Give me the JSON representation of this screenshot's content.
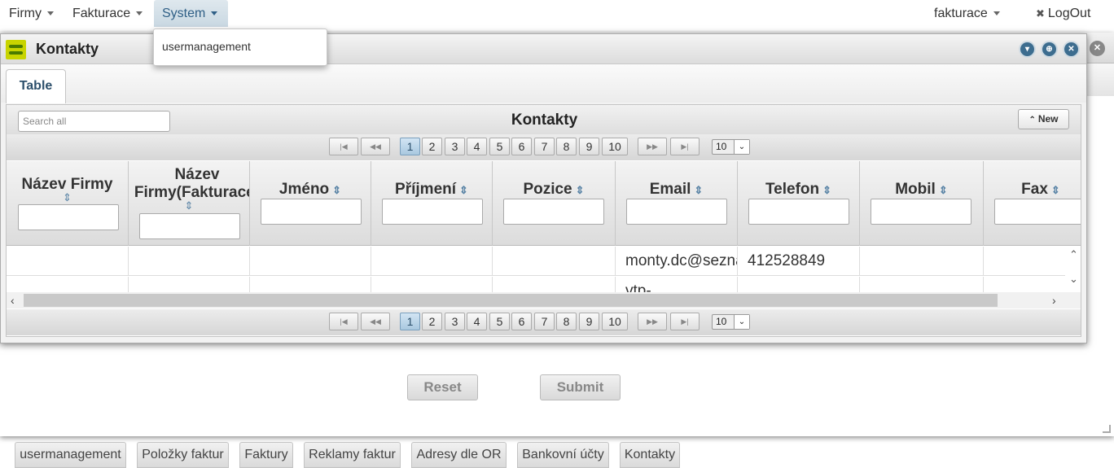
{
  "menubar": {
    "items": [
      {
        "label": "Firmy"
      },
      {
        "label": "Fakturace"
      },
      {
        "label": "System"
      }
    ],
    "user": "fakturace",
    "logout": "LogOut"
  },
  "dropdown": {
    "items": [
      {
        "label": "usermanagement"
      }
    ]
  },
  "background": {
    "reset_label": "Reset",
    "submit_label": "Submit"
  },
  "dialog": {
    "title": "Kontakty",
    "tab": "Table",
    "panel_title": "Kontakty",
    "search_placeholder": "Search all",
    "new_label": "New",
    "pages": [
      "1",
      "2",
      "3",
      "4",
      "5",
      "6",
      "7",
      "8",
      "9",
      "10"
    ],
    "current_page": "1",
    "rows_per_page": "10",
    "columns": [
      {
        "label": "Název Firmy"
      },
      {
        "label": "Název Firmy(Fakturace)"
      },
      {
        "label": "Jméno"
      },
      {
        "label": "Příjmení"
      },
      {
        "label": "Pozice"
      },
      {
        "label": "Email"
      },
      {
        "label": "Telefon"
      },
      {
        "label": "Mobil"
      },
      {
        "label": "Fax"
      }
    ],
    "rows": [
      {
        "cells": [
          "",
          "",
          "",
          "",
          "",
          "monty.dc@seznam.cz",
          "412528849",
          "",
          ""
        ]
      },
      {
        "cells": [
          "",
          "",
          "",
          "",
          "",
          "vtp-",
          "",
          "",
          ""
        ]
      }
    ]
  },
  "taskbar": {
    "tabs": [
      {
        "label": "usermanagement"
      },
      {
        "label": "Položky faktur"
      },
      {
        "label": "Faktury"
      },
      {
        "label": "Reklamy faktur"
      },
      {
        "label": "Adresy dle OR"
      },
      {
        "label": "Bankovní účty"
      },
      {
        "label": "Kontakty"
      }
    ]
  },
  "colors": {
    "accent": "#2f5f86",
    "window_button": "#3d6d8f",
    "app_icon": "#c8d400"
  }
}
